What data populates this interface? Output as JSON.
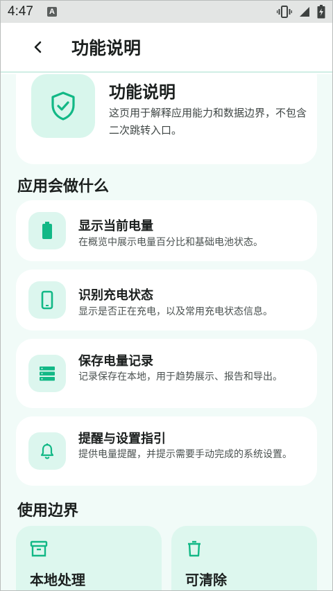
{
  "status_bar": {
    "time": "4:47",
    "notification_letter": "A"
  },
  "app_bar": {
    "title": "功能说明"
  },
  "hero": {
    "title": "功能说明",
    "description": "这页用于解释应用能力和数据边界，不包含二次跳转入口。"
  },
  "section_features": {
    "title": "应用会做什么"
  },
  "features": [
    {
      "title": "显示当前电量",
      "desc": "在概览中展示电量百分比和基础电池状态。",
      "icon": "battery-icon"
    },
    {
      "title": "识别充电状态",
      "desc": "显示是否正在充电，以及常用充电状态信息。",
      "icon": "phone-icon"
    },
    {
      "title": "保存电量记录",
      "desc": "记录保存在本地，用于趋势展示、报告和导出。",
      "icon": "storage-icon"
    },
    {
      "title": "提醒与设置指引",
      "desc": "提供电量提醒，并提示需要手动完成的系统设置。",
      "icon": "bell-icon"
    }
  ],
  "section_boundary": {
    "title": "使用边界"
  },
  "boundaries": [
    {
      "title": "本地处理",
      "icon": "archive-icon"
    },
    {
      "title": "可清除",
      "icon": "trash-icon"
    }
  ],
  "colors": {
    "accent": "#12b886",
    "surface": "#f1fbf8",
    "icon_bg": "#dcf6ee"
  }
}
